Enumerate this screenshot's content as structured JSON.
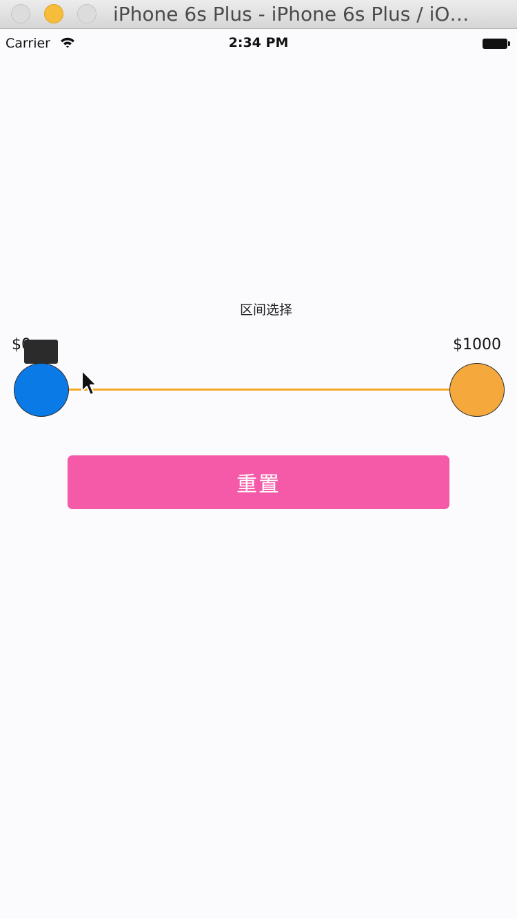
{
  "window": {
    "title": "iPhone 6s Plus - iPhone 6s Plus / iO…"
  },
  "status_bar": {
    "carrier": "Carrier",
    "time": "2:34 PM"
  },
  "range_selector": {
    "title": "区间选择",
    "min_label": "$0",
    "max_label": "$1000",
    "min_value": 0,
    "max_value": 1000,
    "track_color": "#f5a623",
    "min_thumb_color": "#0a7ae6",
    "max_thumb_color": "#f5a93d"
  },
  "reset_button": {
    "label": "重置",
    "color": "#f45aa7"
  },
  "icons": [
    "wifi-icon",
    "battery-icon",
    "mouse-cursor-icon"
  ]
}
